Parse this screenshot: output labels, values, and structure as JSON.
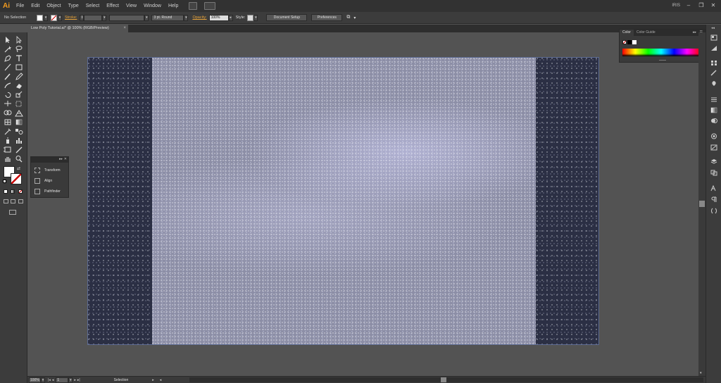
{
  "app": {
    "logo": "Ai",
    "workspace": "IRIS"
  },
  "menu": [
    "File",
    "Edit",
    "Object",
    "Type",
    "Select",
    "Effect",
    "View",
    "Window",
    "Help"
  ],
  "control": {
    "selection": "No Selection",
    "stroke_label": "Stroke:",
    "brush": "3 pt. Round",
    "opacity_label": "Opacity:",
    "opacity_value": "100%",
    "style_label": "Style:",
    "doc_setup": "Document Setup",
    "preferences": "Preferences"
  },
  "document": {
    "tab_title": "Low Poly Tutorial.ai* @ 100% (RGB/Preview)",
    "close": "×"
  },
  "float_panel": {
    "items": [
      "Transform",
      "Align",
      "Pathfinder"
    ]
  },
  "color_panel": {
    "tabs": [
      "Color",
      "Color Guide"
    ]
  },
  "status": {
    "zoom": "100%",
    "page": "1",
    "tool": "Selection"
  },
  "colors": {
    "accent": "#f39c1f",
    "ui_bg": "#535353",
    "panel": "#3c3c3c",
    "dark": "#323232"
  }
}
